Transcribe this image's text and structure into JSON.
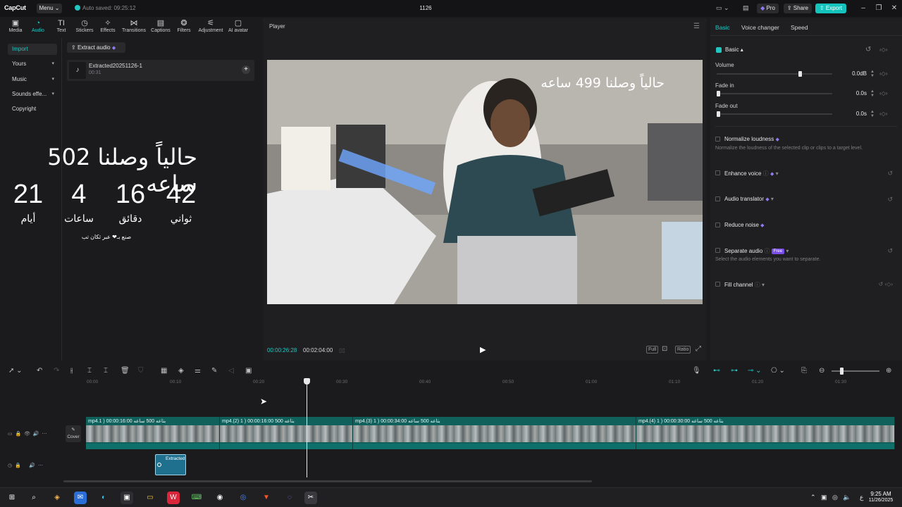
{
  "titlebar": {
    "logo": "CapCut",
    "menu": "Menu",
    "autosave": "Auto saved: 09:25:12",
    "project_title": "1126",
    "pro": "Pro",
    "share": "Share",
    "export": "Export"
  },
  "toolbar": {
    "tabs": [
      {
        "label": "Media",
        "icon": "media-icon"
      },
      {
        "label": "Audio",
        "icon": "audio-icon",
        "active": true
      },
      {
        "label": "Text",
        "icon": "text-icon"
      },
      {
        "label": "Stickers",
        "icon": "stickers-icon"
      },
      {
        "label": "Effects",
        "icon": "effects-icon"
      },
      {
        "label": "Transitions",
        "icon": "transitions-icon"
      },
      {
        "label": "Captions",
        "icon": "captions-icon"
      },
      {
        "label": "Filters",
        "icon": "filters-icon"
      },
      {
        "label": "Adjustment",
        "icon": "adjustment-icon"
      },
      {
        "label": "AI avatar",
        "icon": "ai-avatar-icon"
      }
    ]
  },
  "left_nav": {
    "items": [
      {
        "label": "Import",
        "active": true
      },
      {
        "label": "Yours"
      },
      {
        "label": "Music"
      },
      {
        "label": "Sounds effe..."
      },
      {
        "label": "Copyright"
      }
    ]
  },
  "media": {
    "extract_button": "Extract audio",
    "item_name": "Extracted20251126-1",
    "item_duration": "00:31"
  },
  "overlay": {
    "headline": "حالياً وصلنا 502 ساعه",
    "counters": [
      {
        "value": "21",
        "unit": "أيام"
      },
      {
        "value": "4",
        "unit": "ساعات"
      },
      {
        "value": "16",
        "unit": "دقائق"
      },
      {
        "value": "42",
        "unit": "ثواني"
      }
    ],
    "credit": "صنع بـ❤ عبر ثكان تب"
  },
  "player": {
    "title": "Player",
    "caption": "حالياً وصلنا 499 ساعه",
    "current_time": "00:00:26:28",
    "total_time": "00:02:04:00",
    "full": "Full",
    "ratio": "Ratio"
  },
  "right_panel": {
    "tabs": [
      "Basic",
      "Voice changer",
      "Speed"
    ],
    "section": "Basic",
    "volume_label": "Volume",
    "volume_value": "0.0dB",
    "volume_level": 0.73,
    "fade_in_label": "Fade in",
    "fade_in_value": "0.0s",
    "fade_out_label": "Fade out",
    "fade_out_value": "0.0s",
    "features": [
      {
        "label": "Normalize loudness",
        "desc": "Normalize the loudness of the selected clip or clips to a target level."
      },
      {
        "label": "Enhance voice"
      },
      {
        "label": "Audio translator"
      },
      {
        "label": "Reduce noise"
      },
      {
        "label": "Separate audio",
        "badge": "Free",
        "desc": "Select the audio elements you want to separate."
      },
      {
        "label": "Fill channel"
      }
    ]
  },
  "timeline": {
    "ticks": [
      "00:00",
      "00:10",
      "00:20",
      "00:30",
      "00:40",
      "00:50",
      "01:00",
      "01:10",
      "01:20",
      "01:30"
    ],
    "clips": [
      {
        "label": "mp4.1 )  بتاعه 500 ساعه  00:00:16:00"
      },
      {
        "label": "mp4.(2) 1 )  بتاعه 500  00:00:16:00"
      },
      {
        "label": "mp4.(3) 1 )  بتاعه 500 ساعه  00:00:34:00"
      },
      {
        "label": "mp4.(4) 1 )  بتاعه 500 ساعه  00:00:30:00"
      }
    ],
    "cover": "Cover",
    "audio_clip": "Extracted"
  },
  "taskbar": {
    "time": "9:25 AM",
    "date": "11/26/2025",
    "lang": "ع"
  },
  "colors": {
    "accent": "#22c7c2",
    "export": "#13c3bc",
    "clip": "#10605c"
  }
}
